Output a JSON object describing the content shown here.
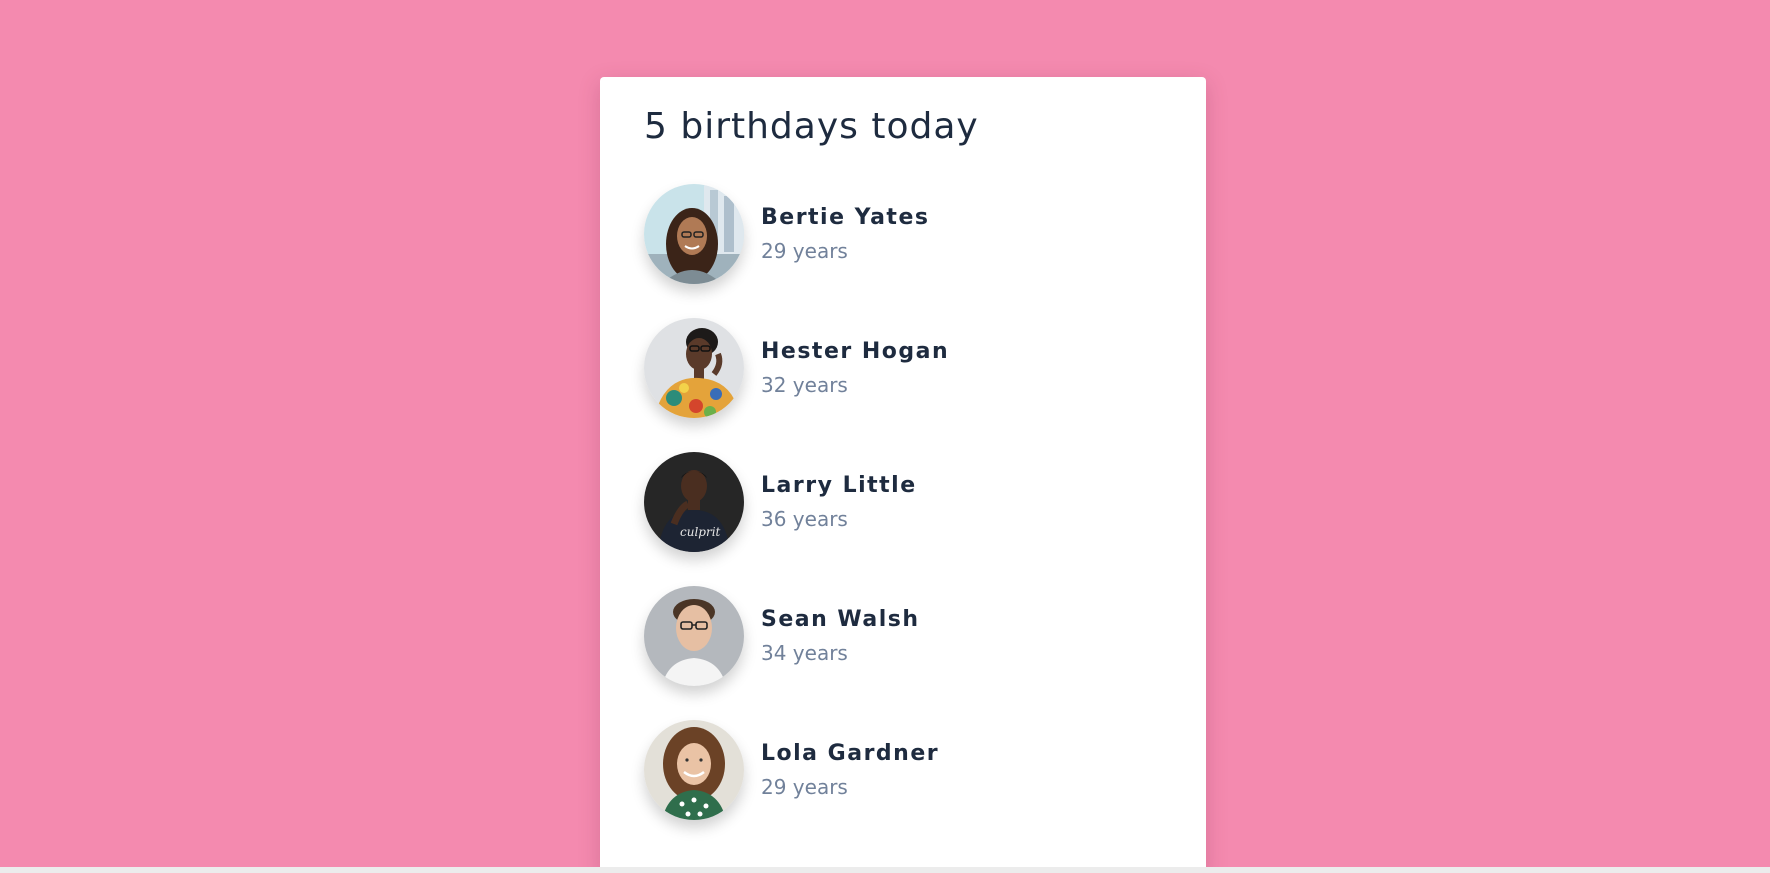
{
  "title": "5 birthdays today",
  "people": [
    {
      "name": "Bertie Yates",
      "age": "29 years"
    },
    {
      "name": "Hester Hogan",
      "age": "32 years"
    },
    {
      "name": "Larry Little",
      "age": "36 years"
    },
    {
      "name": "Sean Walsh",
      "age": "34 years"
    },
    {
      "name": "Lola Gardner",
      "age": "29 years"
    }
  ],
  "colors": {
    "background": "#f48aaf",
    "card": "#ffffff",
    "heading": "#1e2b3f",
    "subtext": "#71819a"
  }
}
